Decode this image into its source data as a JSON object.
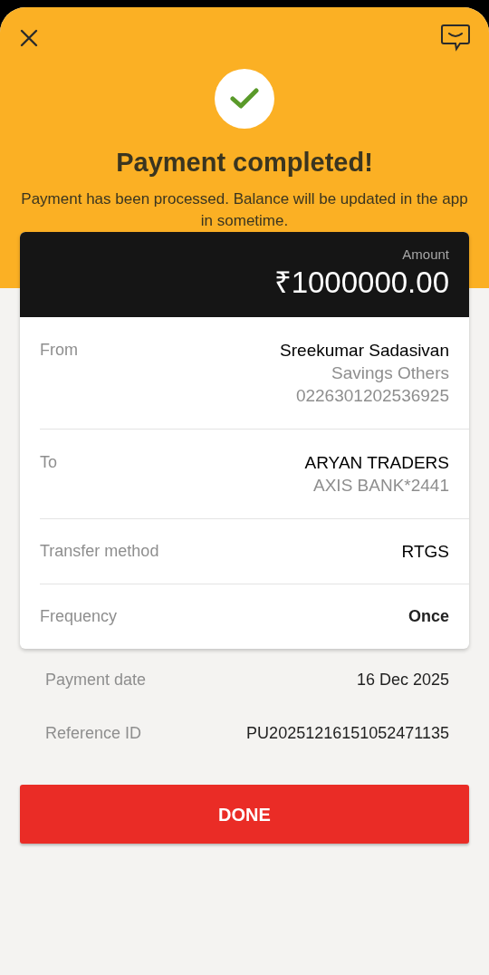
{
  "header": {
    "title": "Payment completed!",
    "message": "Payment has been processed. Balance will be updated in the app in sometime."
  },
  "amount": {
    "label": "Amount",
    "value": "₹1000000.00"
  },
  "details": [
    {
      "label": "From",
      "lines": [
        {
          "text": "Sreekumar Sadasivan",
          "kind": "primary"
        },
        {
          "text": "Savings Others",
          "kind": "secondary"
        },
        {
          "text": "0226301202536925",
          "kind": "secondary"
        }
      ]
    },
    {
      "label": "To",
      "lines": [
        {
          "text": "ARYAN TRADERS",
          "kind": "primary"
        },
        {
          "text": "AXIS BANK*2441",
          "kind": "secondary"
        }
      ]
    },
    {
      "label": "Transfer method",
      "lines": [
        {
          "text": "RTGS",
          "kind": "primary"
        }
      ]
    },
    {
      "label": "Frequency",
      "lines": [
        {
          "text": "Once",
          "kind": "bold"
        }
      ]
    }
  ],
  "extra": [
    {
      "label": "Payment date",
      "value": "16 Dec 2025"
    },
    {
      "label": "Reference ID",
      "value": "PU20251216151052471135"
    }
  ],
  "done_button": "DONE"
}
